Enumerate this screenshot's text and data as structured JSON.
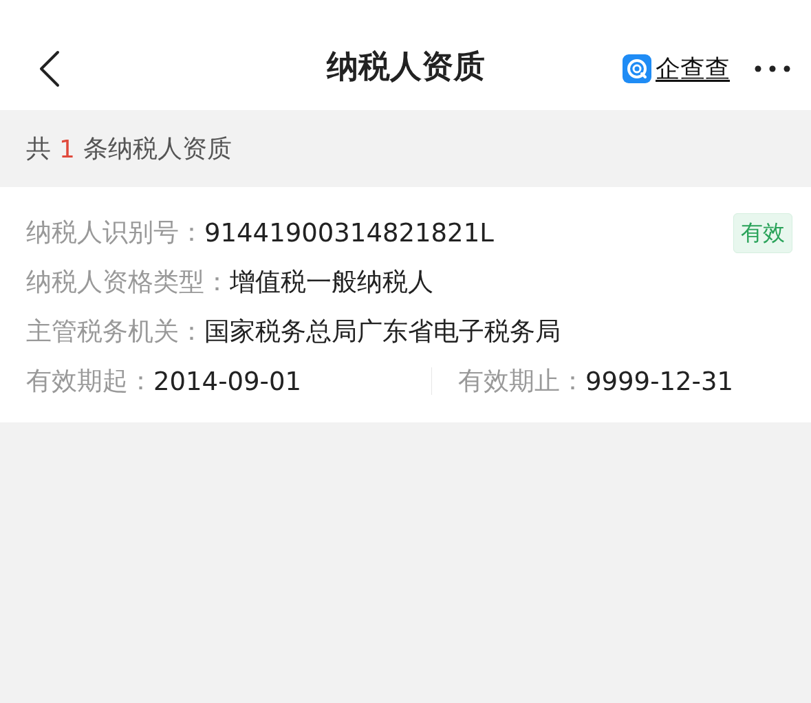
{
  "header": {
    "title": "纳税人资质",
    "brand": "企查查"
  },
  "summary": {
    "prefix": "共",
    "count": "1",
    "suffix": "条纳税人资质"
  },
  "record": {
    "status": {
      "label": "有效",
      "kind": "valid"
    },
    "rows": [
      {
        "items": [
          {
            "label": "纳税人识别号：",
            "value": "91441900314821821L"
          }
        ]
      },
      {
        "items": [
          {
            "label": "纳税人资格类型：",
            "value": "增值税一般纳税人"
          }
        ]
      },
      {
        "items": [
          {
            "label": "主管税务机关：",
            "value": "国家税务总局广东省电子税务局"
          }
        ]
      },
      {
        "items": [
          {
            "label": "有效期起：",
            "value": "2014-09-01"
          },
          {
            "label": "有效期止：",
            "value": "9999-12-31"
          }
        ]
      }
    ]
  }
}
